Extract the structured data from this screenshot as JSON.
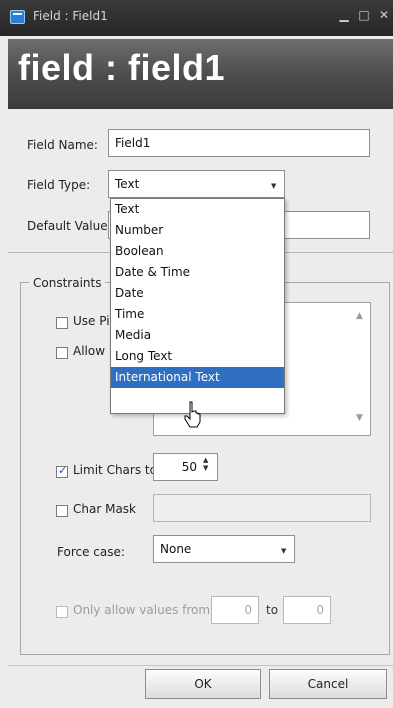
{
  "window": {
    "title": "Field : Field1"
  },
  "header": {
    "title": "field : field1"
  },
  "form": {
    "field_name_label": "Field Name:",
    "field_name_value": "Field1",
    "field_type_label": "Field Type:",
    "field_type_value": "Text",
    "default_value_label": "Default Value:"
  },
  "field_type_options": [
    "Text",
    "Number",
    "Boolean",
    "Date & Time",
    "Date",
    "Time",
    "Media",
    "Long Text",
    "International Text"
  ],
  "field_type_highlighted": "International Text",
  "constraints": {
    "legend": "Constraints",
    "use_picklist_label": "Use Pic",
    "allow_edit_label": "Allow E",
    "limit_chars_label": "Limit Chars to",
    "limit_chars_checked": true,
    "limit_chars_value": "50",
    "char_mask_label": "Char Mask",
    "force_case_label": "Force case:",
    "force_case_value": "None",
    "only_allow_label": "Only allow values from:",
    "range_from": "0",
    "range_to_label": "to",
    "range_to": "0"
  },
  "buttons": {
    "ok": "OK",
    "cancel": "Cancel"
  },
  "colors": {
    "selection": "#2f6fc1",
    "titlebar": "#2a2a2a",
    "banner": "#555555"
  },
  "icons": {
    "window": "app-icon",
    "minimize": "minimize-icon",
    "maximize": "maximize-icon",
    "close": "close-icon",
    "cursor": "pointer-cursor-icon"
  }
}
